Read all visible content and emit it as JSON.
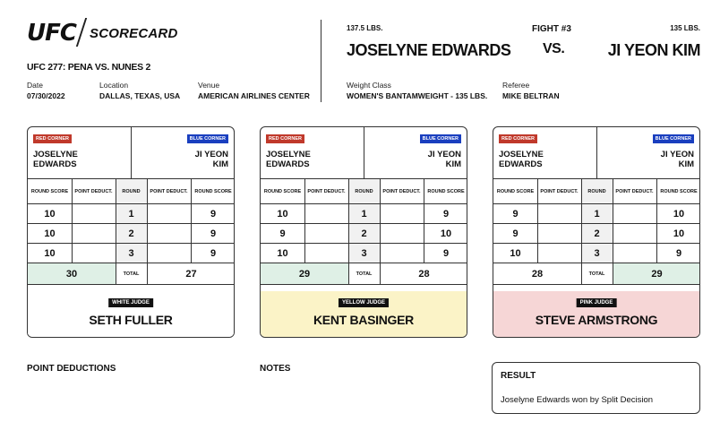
{
  "header": {
    "logo": "UFC",
    "title": "SCORECARD",
    "event": "UFC 277: PENA VS. NUNES 2",
    "date_label": "Date",
    "date": "07/30/2022",
    "location_label": "Location",
    "location": "DALLAS, TEXAS, USA",
    "venue_label": "Venue",
    "venue": "AMERICAN AIRLINES CENTER"
  },
  "bout": {
    "red_weight": "137.5 LBS.",
    "red_name": "JOSELYNE EDWARDS",
    "fight_no": "FIGHT #3",
    "vs": "VS.",
    "blue_weight": "135 LBS.",
    "blue_name": "JI YEON KIM",
    "weightclass_label": "Weight Class",
    "weightclass": "WOMEN'S BANTAMWEIGHT - 135 LBS.",
    "referee_label": "Referee",
    "referee": "MIKE BELTRAN"
  },
  "labels": {
    "red_corner": "RED CORNER",
    "blue_corner": "BLUE CORNER",
    "red_first": "JOSELYNE",
    "red_last": "EDWARDS",
    "blue_first": "JI YEON",
    "blue_last": "KIM",
    "round_score": "ROUND SCORE",
    "point_deduct": "POINT DEDUCT.",
    "round": "ROUND",
    "total": "TOTAL"
  },
  "cards": [
    {
      "judge_color": "WHITE JUDGE",
      "judge_name": "SETH FULLER",
      "bg": "#ffffff",
      "total_bg_side": "red",
      "rounds": [
        {
          "n": "1",
          "red": "10",
          "blue": "9"
        },
        {
          "n": "2",
          "red": "10",
          "blue": "9"
        },
        {
          "n": "3",
          "red": "10",
          "blue": "9"
        }
      ],
      "red_total": "30",
      "blue_total": "27"
    },
    {
      "judge_color": "YELLOW JUDGE",
      "judge_name": "KENT BASINGER",
      "bg": "#fbf3c7",
      "total_bg_side": "red",
      "rounds": [
        {
          "n": "1",
          "red": "10",
          "blue": "9"
        },
        {
          "n": "2",
          "red": "9",
          "blue": "10"
        },
        {
          "n": "3",
          "red": "10",
          "blue": "9"
        }
      ],
      "red_total": "29",
      "blue_total": "28"
    },
    {
      "judge_color": "PINK JUDGE",
      "judge_name": "STEVE ARMSTRONG",
      "bg": "#f6d6d6",
      "total_bg_side": "blue",
      "rounds": [
        {
          "n": "1",
          "red": "9",
          "blue": "10"
        },
        {
          "n": "2",
          "red": "9",
          "blue": "10"
        },
        {
          "n": "3",
          "red": "10",
          "blue": "9"
        }
      ],
      "red_total": "28",
      "blue_total": "29"
    }
  ],
  "footer": {
    "point_deductions": "POINT DEDUCTIONS",
    "notes": "NOTES",
    "result_title": "RESULT",
    "result_text": "Joselyne Edwards won by Split Decision"
  },
  "colors": {
    "winner_total_bg": "#dff0e6",
    "red_badge": "#c0392b",
    "blue_badge": "#1a3fbf"
  }
}
